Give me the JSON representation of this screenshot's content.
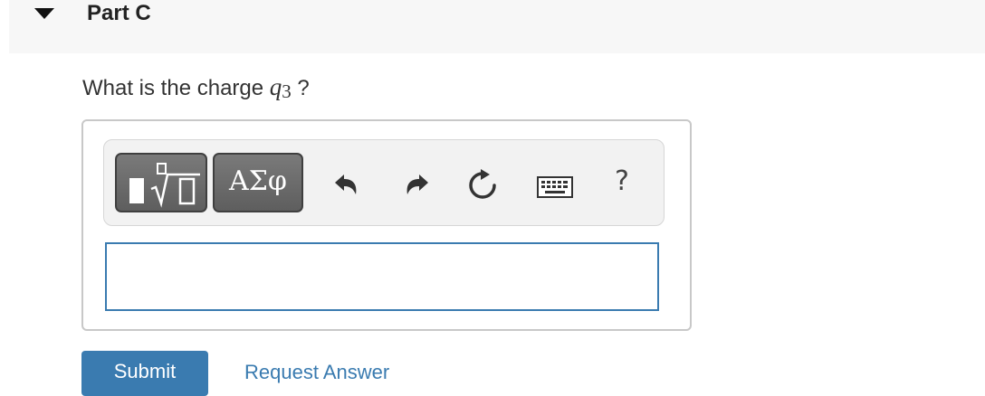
{
  "part": {
    "title": "Part C"
  },
  "question": {
    "prefix": "What is the charge ",
    "variable": "q",
    "subscript": "3",
    "suffix": " ?"
  },
  "toolbar": {
    "symbols_label": "ΑΣφ",
    "help_label": "?",
    "icons": [
      "templates-icon",
      "undo-icon",
      "redo-icon",
      "reset-icon",
      "keyboard-icon",
      "help-icon"
    ]
  },
  "answer": {
    "value": "",
    "placeholder": ""
  },
  "actions": {
    "submit_label": "Submit",
    "request_label": "Request Answer"
  },
  "colors": {
    "accent": "#3a7bb0",
    "header_bg": "#f7f7f7",
    "button_dark": "#6b6b6b"
  }
}
